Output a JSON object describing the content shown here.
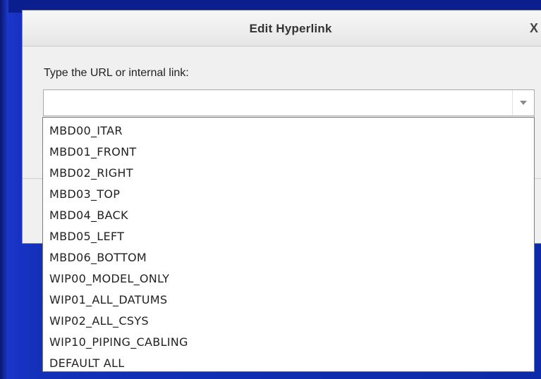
{
  "dialog": {
    "title": "Edit Hyperlink",
    "close_label": "X",
    "url_label": "Type the URL or internal link:",
    "url_value": "",
    "url_placeholder": ""
  },
  "dropdown": {
    "items": [
      "MBD00_ITAR",
      "MBD01_FRONT",
      "MBD02_RIGHT",
      "MBD03_TOP",
      "MBD04_BACK",
      "MBD05_LEFT",
      "MBD06_BOTTOM",
      "WIP00_MODEL_ONLY",
      "WIP01_ALL_DATUMS",
      "WIP02_ALL_CSYS",
      "WIP10_PIPING_CABLING",
      "DEFAULT ALL"
    ]
  },
  "colors": {
    "background": "#1230b8",
    "dialog": "#f0f0f0",
    "list": "#ffffff"
  },
  "icons": {
    "close": "close-icon",
    "combo_arrow": "chevron-down-icon"
  }
}
